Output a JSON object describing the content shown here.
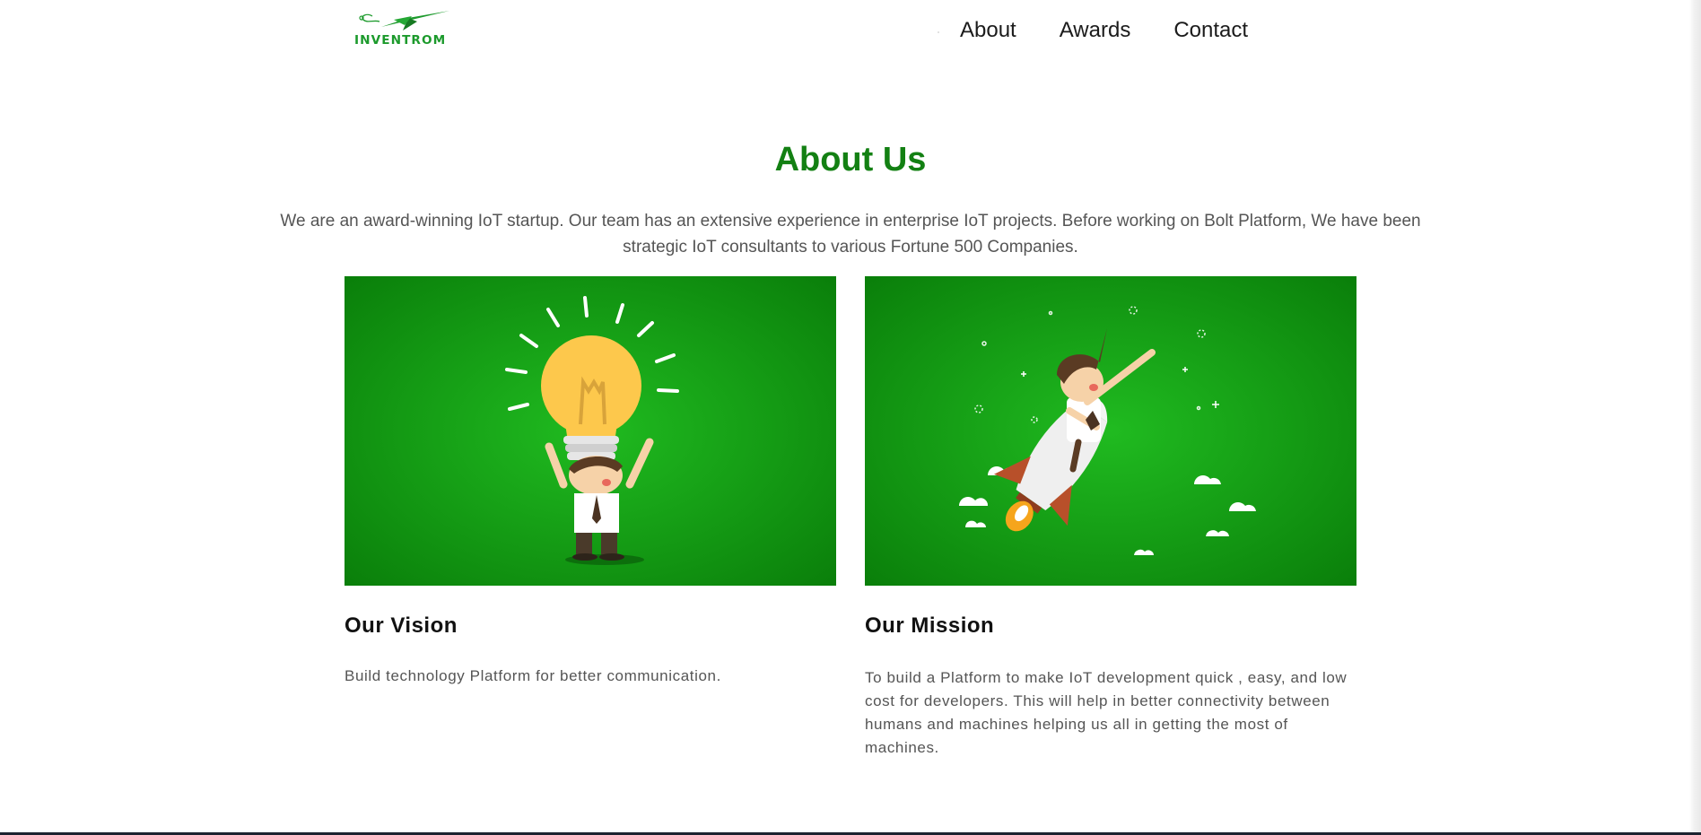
{
  "header": {
    "logo_text": "INVENTROM",
    "nav": [
      {
        "label": "About"
      },
      {
        "label": "Awards"
      },
      {
        "label": "Contact"
      }
    ]
  },
  "about": {
    "title": "About Us",
    "description": "We are an award-winning IoT startup. Our team has an extensive experience in enterprise IoT projects. Before working on Bolt Platform, We have been strategic IoT consultants to various Fortune 500 Companies."
  },
  "cards": [
    {
      "title": "Our Vision",
      "text": "Build technology Platform for better communication.",
      "image_icon": "lightbulb-man-illustration"
    },
    {
      "title": "Our Mission",
      "text": "To build a Platform to make IoT development quick , easy, and low cost for developers. This will help in better connectivity between humans and machines helping us all in getting the most of machines.",
      "image_icon": "rocket-man-illustration"
    }
  ],
  "colors": {
    "brand_green": "#138013",
    "logo_green": "#1c9a2c",
    "image_bg_center": "#1fb81f",
    "image_bg_edge": "#0a7f0a"
  }
}
